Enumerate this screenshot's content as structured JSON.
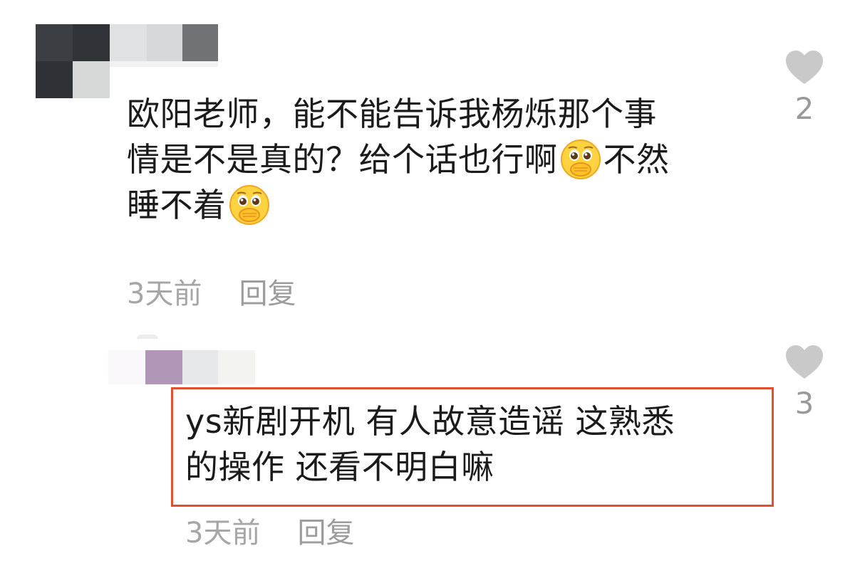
{
  "comments": [
    {
      "text_parts": [
        "欧阳老师，能不能告诉我杨烁那个事",
        "情是不是真的？给个话也行啊",
        "不然",
        "睡不着"
      ],
      "time": "3天前",
      "reply_label": "回复",
      "like_count": "2",
      "emoji_icon": "shy-pleading-face-emoji"
    },
    {
      "text_parts": [
        "ys新剧开机 有人故意造谣 这熟悉",
        "的操作 还看不明白嘛"
      ],
      "time": "3天前",
      "reply_label": "回复",
      "like_count": "3"
    }
  ],
  "colors": {
    "text": "#1b1b1b",
    "meta": "#a6a6a6",
    "heart": "#c9c9c9",
    "highlight_border": "#e4502d"
  }
}
